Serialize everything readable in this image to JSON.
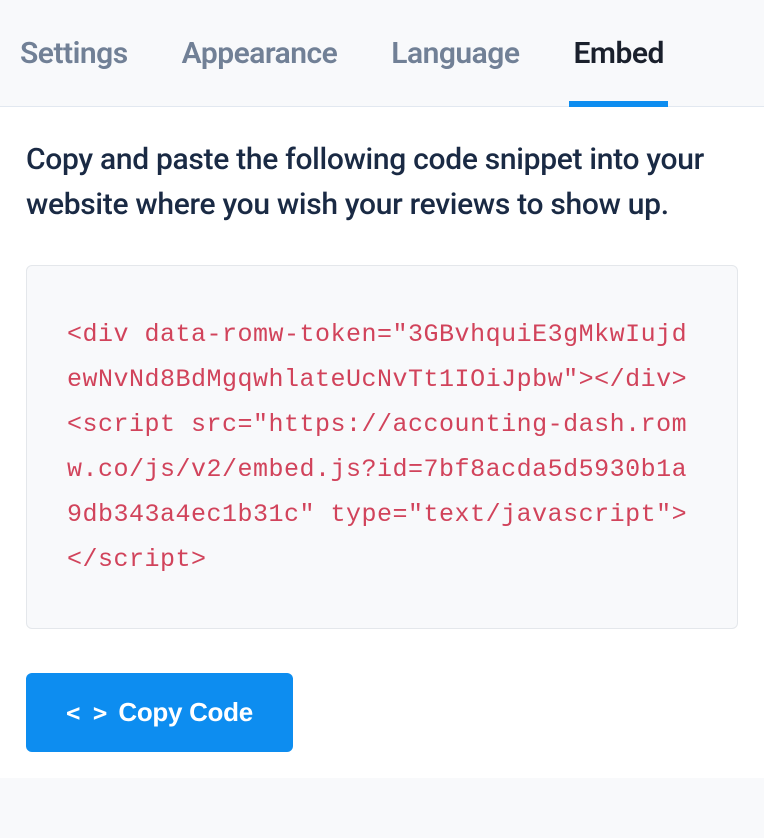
{
  "tabs": {
    "settings": "Settings",
    "appearance": "Appearance",
    "language": "Language",
    "embed": "Embed"
  },
  "instruction": "Copy and paste the following code snippet into your website where you wish your reviews to show up.",
  "code_snippet": "<div data-romw-token=\"3GBvhquiE3gMkwIujdewNvNd8BdMgqwhlateUcNvTt1IOiJpbw\"></div>\n<script src=\"https://accounting-dash.romw.co/js/v2/embed.js?id=7bf8acda5d5930b1a9db343a4ec1b31c\" type=\"text/javascript\"></script>",
  "copy_button": {
    "icon": "< >",
    "label": "Copy Code"
  }
}
